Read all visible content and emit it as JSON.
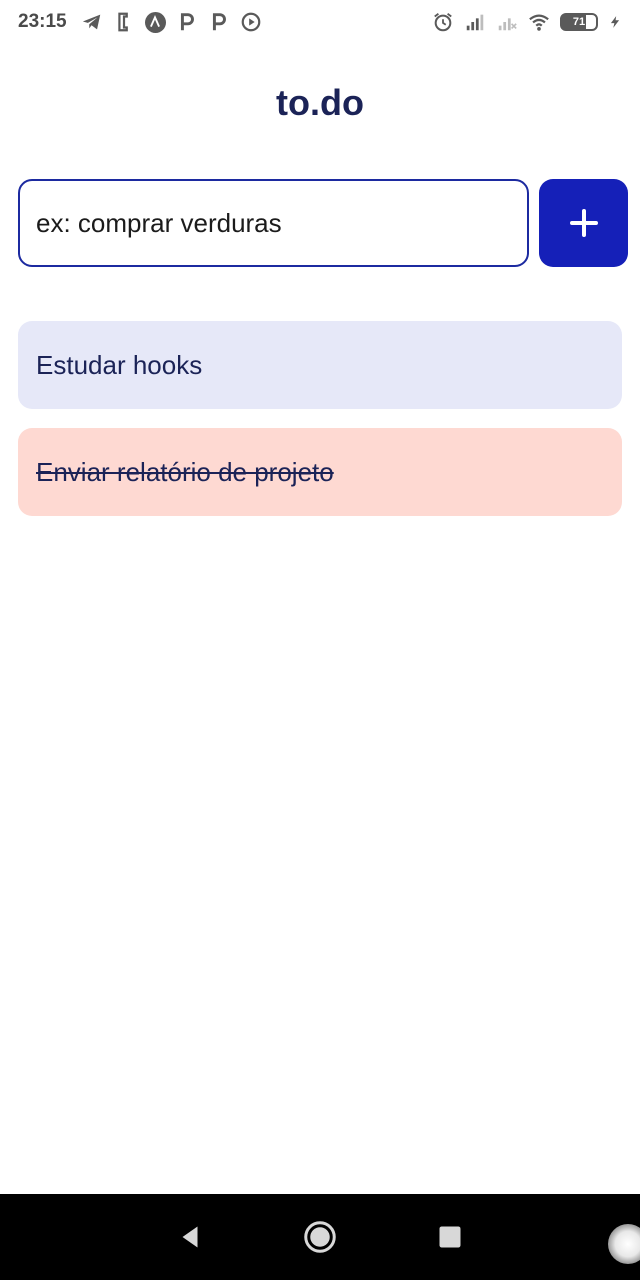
{
  "status_bar": {
    "time": "23:15",
    "left_icons": [
      "telegram-icon",
      "notification-icon",
      "app-a-icon",
      "app-p-icon",
      "app-p-icon",
      "media-icon"
    ],
    "right_icons": [
      "alarm-icon",
      "signal-icon",
      "signal-off-icon",
      "wifi-icon",
      "battery-icon",
      "charging-icon"
    ],
    "battery_level": "71"
  },
  "app": {
    "title": "to.do"
  },
  "input": {
    "placeholder": "ex: comprar verduras",
    "value": ""
  },
  "add_button": {
    "icon": "plus-icon"
  },
  "tasks": [
    {
      "text": "Estudar hooks",
      "done": false
    },
    {
      "text": "Enviar relatório de projeto ",
      "done": true
    }
  ],
  "colors": {
    "primary": "#1520b8",
    "title": "#1b2357",
    "pending_bg": "#e6e8f8",
    "done_bg": "#fed9d2"
  },
  "nav_bar": {
    "buttons": [
      "back-icon",
      "home-icon",
      "recents-icon"
    ]
  }
}
